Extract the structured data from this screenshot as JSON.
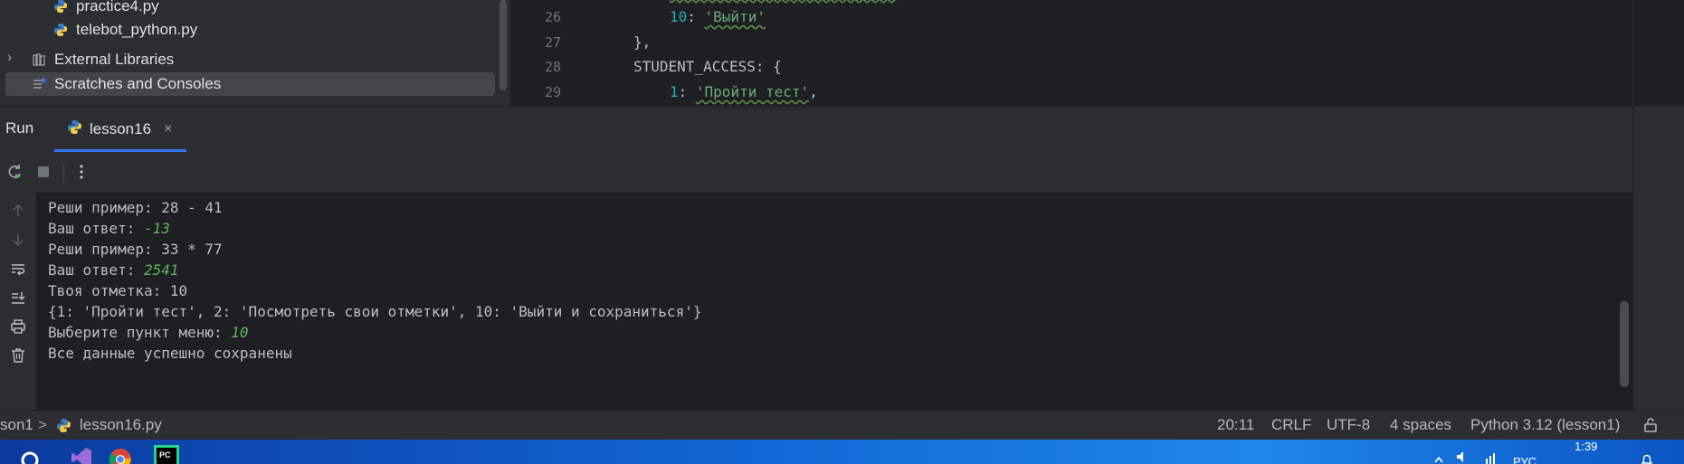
{
  "project_tree": {
    "items": [
      {
        "label": "practice4.py",
        "icon": "python-file-icon"
      },
      {
        "label": "telebot_python.py",
        "icon": "python-file-icon"
      },
      {
        "label": "External Libraries",
        "icon": "library-icon"
      },
      {
        "label": "Scratches and Consoles",
        "icon": "scratches-icon"
      }
    ]
  },
  "editor": {
    "line_numbers": [
      "26",
      "27",
      "28",
      "29"
    ],
    "line26": {
      "key": "10",
      "sep": ": ",
      "value": "'Выйти'"
    },
    "line27": "},",
    "line28": "STUDENT_ACCESS: {",
    "line29": {
      "key": "1",
      "sep": ": ",
      "value": "'Пройти тест'",
      "tail": ","
    }
  },
  "run": {
    "title": "Run",
    "tab_label": "lesson16",
    "close_glyph": "×"
  },
  "console": {
    "lines": [
      {
        "text": "Реши пример: 28 - 41",
        "input": ""
      },
      {
        "text": "Ваш ответ: ",
        "input": "-13"
      },
      {
        "text": "Реши пример: 33 * 77",
        "input": ""
      },
      {
        "text": "Ваш ответ: ",
        "input": "2541"
      },
      {
        "text": "Твоя отметка: 10",
        "input": ""
      },
      {
        "text": "{1: 'Пройти тест', 2: 'Посмотреть свои отметки', 10: 'Выйти и сохраниться'}",
        "input": ""
      },
      {
        "text": "Выберите пункт меню: ",
        "input": "10"
      },
      {
        "text": "Все данные успешно сохранены",
        "input": ""
      }
    ]
  },
  "status_bar": {
    "breadcrumb_project": "son1",
    "breadcrumb_sep": ">",
    "breadcrumb_file": "lesson16.py",
    "position": "20:11",
    "line_ending": "CRLF",
    "encoding": "UTF-8",
    "indent": "4 spaces",
    "interpreter": "Python 3.12 (lesson1)"
  },
  "taskbar": {
    "time": "1:39",
    "lang": "РУС"
  },
  "colors": {
    "accent": "#3574f0",
    "string": "#6aab73",
    "number": "#2aacb8",
    "input": "#5fb35c"
  }
}
